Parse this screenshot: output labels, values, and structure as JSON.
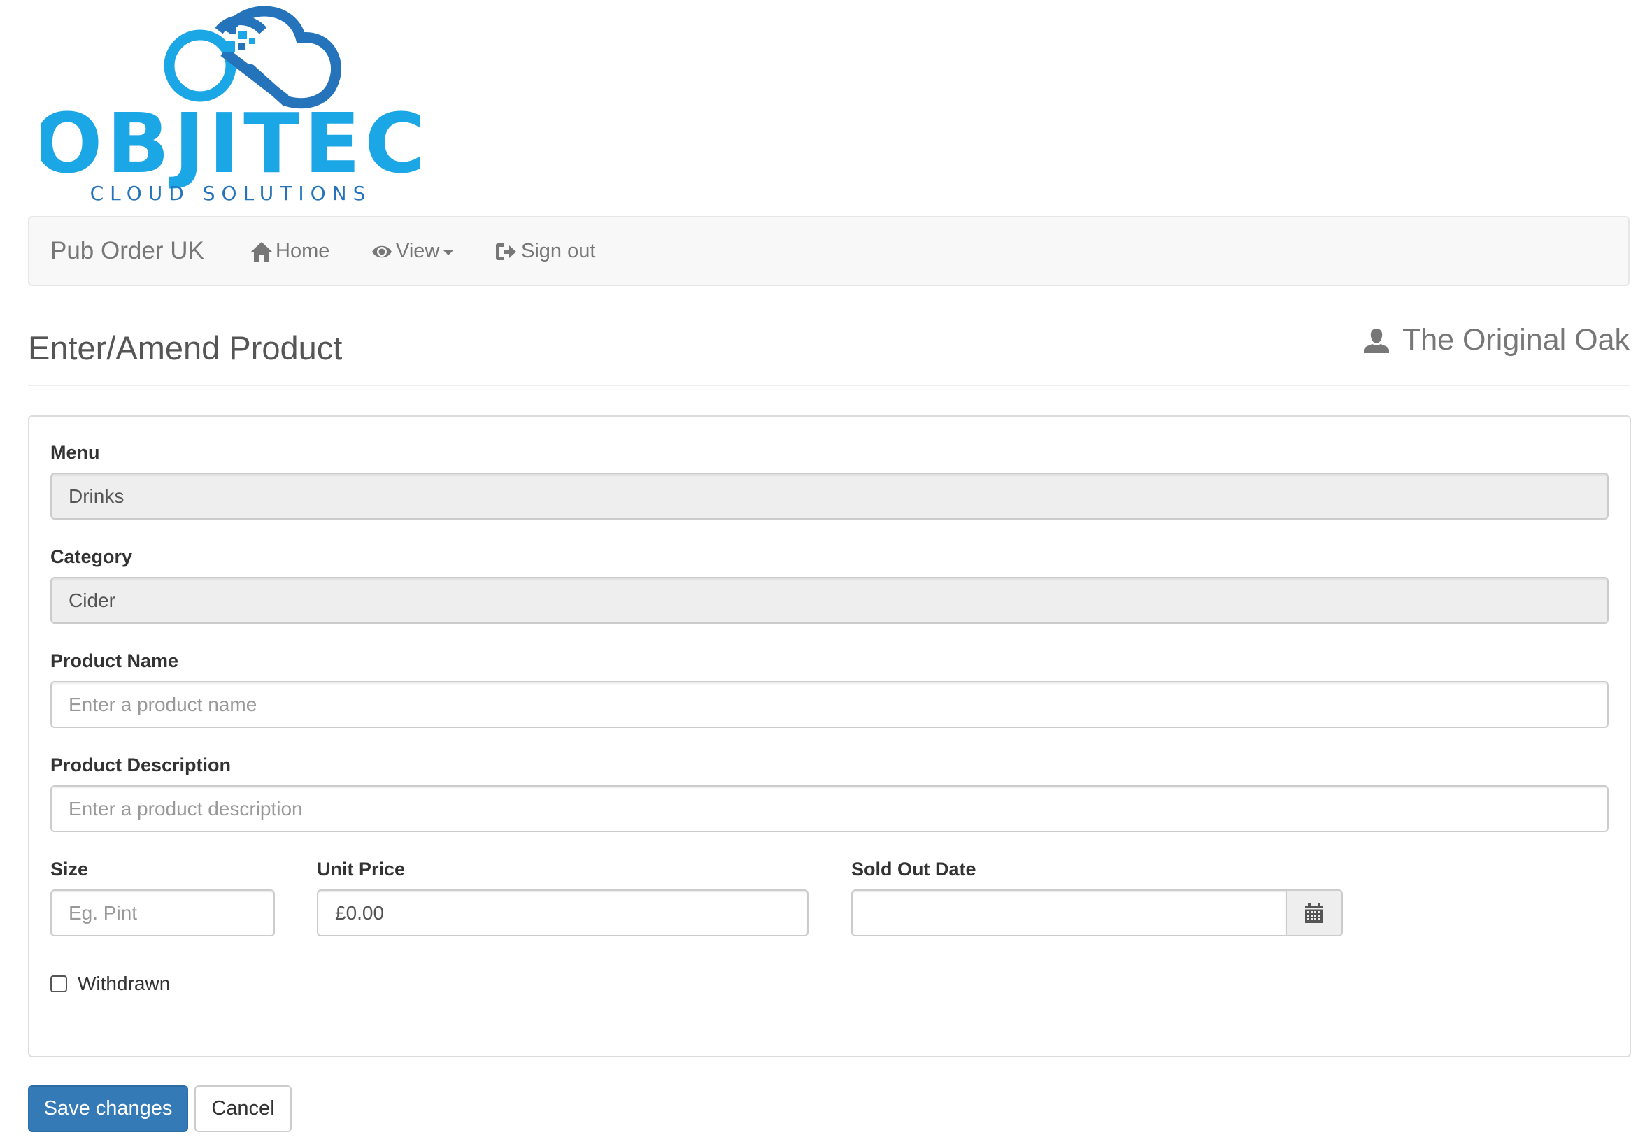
{
  "logo": {
    "name": "OBJITEC",
    "tagline": "CLOUD SOLUTIONS",
    "colors": {
      "light_blue": "#1ba6e6",
      "dark_blue": "#2574bb"
    }
  },
  "navbar": {
    "brand": "Pub Order UK",
    "items": [
      {
        "label": "Home",
        "icon": "home-icon"
      },
      {
        "label": "View",
        "icon": "eye-icon",
        "dropdown": true
      },
      {
        "label": "Sign out",
        "icon": "log-out-icon"
      }
    ]
  },
  "header": {
    "title": "Enter/Amend Product",
    "user": "The Original Oak",
    "user_icon": "user-icon"
  },
  "form": {
    "menu": {
      "label": "Menu",
      "value": "Drinks",
      "readonly": true
    },
    "category": {
      "label": "Category",
      "value": "Cider",
      "readonly": true
    },
    "product_name": {
      "label": "Product Name",
      "value": "",
      "placeholder": "Enter a product name"
    },
    "product_description": {
      "label": "Product Description",
      "value": "",
      "placeholder": "Enter a product description"
    },
    "size": {
      "label": "Size",
      "value": "",
      "placeholder": "Eg. Pint"
    },
    "unit_price": {
      "label": "Unit Price",
      "value": "£0.00"
    },
    "sold_out_date": {
      "label": "Sold Out Date",
      "value": "",
      "icon": "calendar-icon"
    },
    "withdrawn": {
      "label": "Withdrawn",
      "checked": false
    }
  },
  "actions": {
    "save_label": "Save changes",
    "cancel_label": "Cancel"
  },
  "theme": {
    "primary": "#337ab7",
    "navbar_bg": "#f8f8f8",
    "readonly_bg": "#eeeeee"
  }
}
